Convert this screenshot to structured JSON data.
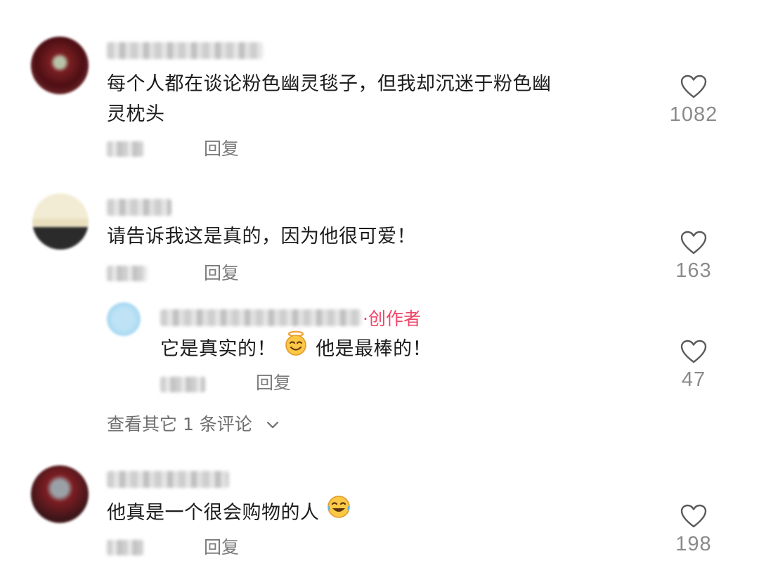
{
  "comments": [
    {
      "text_line1": "每个人都在谈论粉色幽灵毯子，但我却沉迷于粉色幽",
      "text_line2": "灵枕头",
      "reply_label": "回复",
      "like_count": "1082",
      "avatar_icon": "blurred-avatar-red"
    },
    {
      "text": "请告诉我这是真的，因为他很可爱！",
      "reply_label": "回复",
      "like_count": "163",
      "avatar_icon": "blurred-avatar-cream"
    },
    {
      "text": "他真是一个很会购物的人",
      "reply_label": "回复",
      "like_count": "198",
      "avatar_icon": "blurred-avatar-dark-red"
    }
  ],
  "reply": {
    "creator_separator": "·",
    "creator_tag": "创作者",
    "text_part1": "它是真实的！",
    "text_part2": "他是最棒的！",
    "emoji_icon": "smiling-face-with-halo-icon",
    "reply_label": "回复",
    "like_count": "47",
    "avatar_icon": "blurred-avatar-light-blue"
  },
  "view_more": {
    "label": "查看其它 1 条评论"
  },
  "colors": {
    "creator_accent": "#f04668",
    "secondary_text": "#7b7b7b",
    "like_count": "#8a8a8a"
  }
}
